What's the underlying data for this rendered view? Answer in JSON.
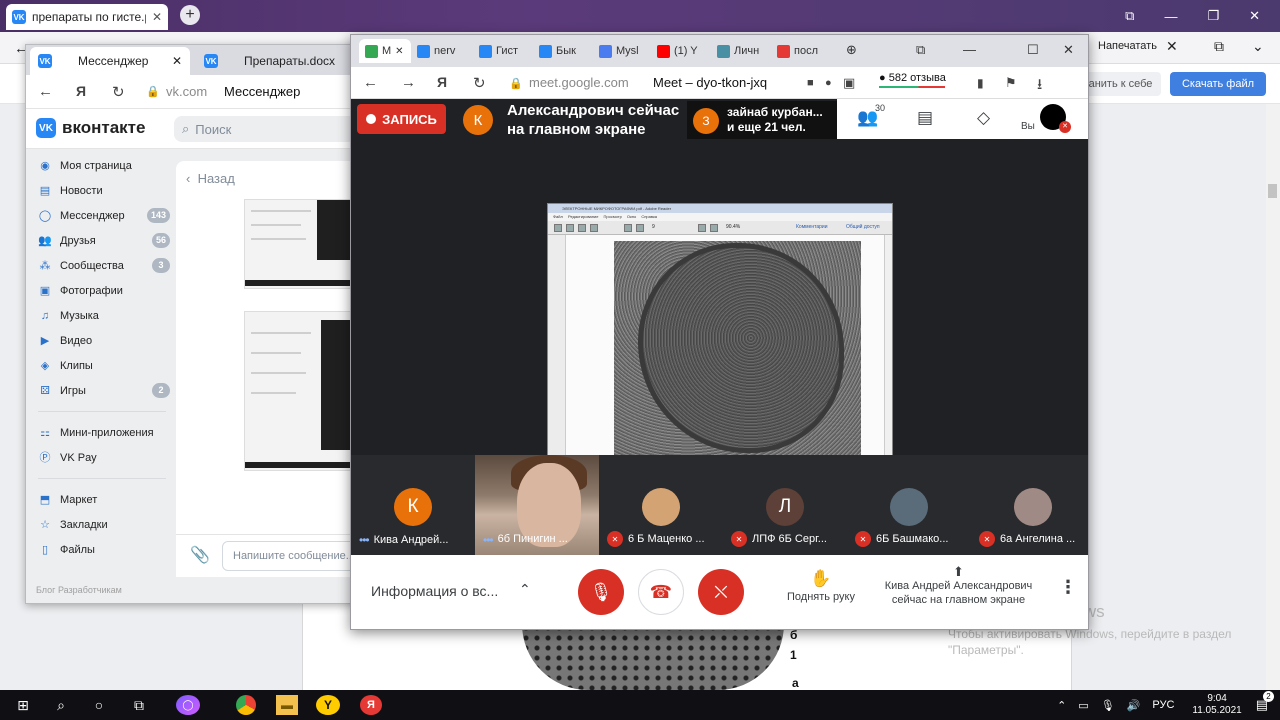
{
  "bg_browser": {
    "tab_title": "препараты по гисте.pdf",
    "print_label": "Напечатать",
    "save_label": "анить к себе",
    "download_label": "Скачать файл",
    "doc_labels": [
      "б",
      "1",
      "а"
    ]
  },
  "vk_window": {
    "tabs": [
      {
        "label": "Мессенджер"
      },
      {
        "label": "Препараты.docx"
      }
    ],
    "address": {
      "domain": "vk.com",
      "page_title": "Мессенджер"
    },
    "logo": "вконтакте",
    "search_placeholder": "Поиск",
    "sidebar": [
      {
        "label": "Моя страница",
        "icon": "user-circle-icon",
        "badge": ""
      },
      {
        "label": "Новости",
        "icon": "news-icon",
        "badge": ""
      },
      {
        "label": "Мессенджер",
        "icon": "message-icon",
        "badge": "143"
      },
      {
        "label": "Друзья",
        "icon": "friends-icon",
        "badge": "56"
      },
      {
        "label": "Сообщества",
        "icon": "communities-icon",
        "badge": "3"
      },
      {
        "label": "Фотографии",
        "icon": "photo-icon",
        "badge": ""
      },
      {
        "label": "Музыка",
        "icon": "music-icon",
        "badge": ""
      },
      {
        "label": "Видео",
        "icon": "video-icon",
        "badge": ""
      },
      {
        "label": "Клипы",
        "icon": "clips-icon",
        "badge": ""
      },
      {
        "label": "Игры",
        "icon": "games-icon",
        "badge": "2"
      }
    ],
    "sidebar2": [
      {
        "label": "Мини-приложения",
        "icon": "apps-icon"
      },
      {
        "label": "VK Pay",
        "icon": "pay-icon"
      }
    ],
    "sidebar3": [
      {
        "label": "Маркет",
        "icon": "market-icon"
      },
      {
        "label": "Закладки",
        "icon": "star-icon"
      },
      {
        "label": "Файлы",
        "icon": "file-icon"
      }
    ],
    "back_label": "Назад",
    "compose_placeholder": "Напишите сообщение...",
    "footer": "Блог   Разработчикам"
  },
  "meet_window": {
    "tabs": [
      "M",
      "nerv",
      "Гист",
      "Бык",
      "Mysl",
      "(1) Y",
      "Личн",
      "посл"
    ],
    "address": {
      "domain": "meet.google.com",
      "page_title": "Meet – dyo-tkon-jxq"
    },
    "reviews": "582 отзыва",
    "recording_label": "ЗАПИСЬ",
    "presenter_initial": "К",
    "presenter_message": "Александрович сейчас на главном экране",
    "joined_initial": "З",
    "joined_line1": "зайнаб курбан...",
    "joined_line2": "и еще 21 чел.",
    "people_count": "30",
    "you_label": "Вы",
    "shared_doc": {
      "title": "ЭЛЕКТРОННЫЕ МИКРОФОТОГРАФИИ.pdf - Adobe Reader",
      "menu": "Файл Редактирование Просмотр Окно Справка",
      "page_num": "9",
      "zoom": "90.4%",
      "comments": "Комментарии",
      "share": "Общий доступ"
    },
    "participants": [
      {
        "initial": "К",
        "name": "Кива Андрей...",
        "color": "#e8710a",
        "muted": false,
        "speaking": true
      },
      {
        "initial": "",
        "name": "6б Пинигин ...",
        "color": "",
        "muted": false,
        "speaking": true
      },
      {
        "initial": "",
        "name": "6 Б Маценко ...",
        "color": "#d4a373",
        "muted": true,
        "speaking": false
      },
      {
        "initial": "Л",
        "name": "ЛПФ 6Б Серг...",
        "color": "#5d4037",
        "muted": true,
        "speaking": false
      },
      {
        "initial": "",
        "name": "6Б Башмако...",
        "color": "#5a6b7a",
        "muted": true,
        "speaking": false
      },
      {
        "initial": "",
        "name": "6а Ангелина ...",
        "color": "#a08a86",
        "muted": true,
        "speaking": false
      }
    ],
    "bottom": {
      "info": "Информация о вс...",
      "raise_hand": "Поднять руку",
      "presenting_line1": "Кива Андрей Александрович",
      "presenting_line2": "сейчас на главном экране"
    }
  },
  "activate_windows": {
    "title": "Активация Windows",
    "text1": "Чтобы активировать Windows, перейдите в раздел",
    "text2": "\"Параметры\"."
  },
  "taskbar": {
    "language": "РУС",
    "time": "9:04",
    "date": "11.05.2021",
    "notifications": "2"
  },
  "colors": {
    "vk_blue": "#2787f5",
    "meet_red": "#d93025",
    "meet_orange": "#e8710a",
    "download_blue": "#3f7fe0"
  }
}
